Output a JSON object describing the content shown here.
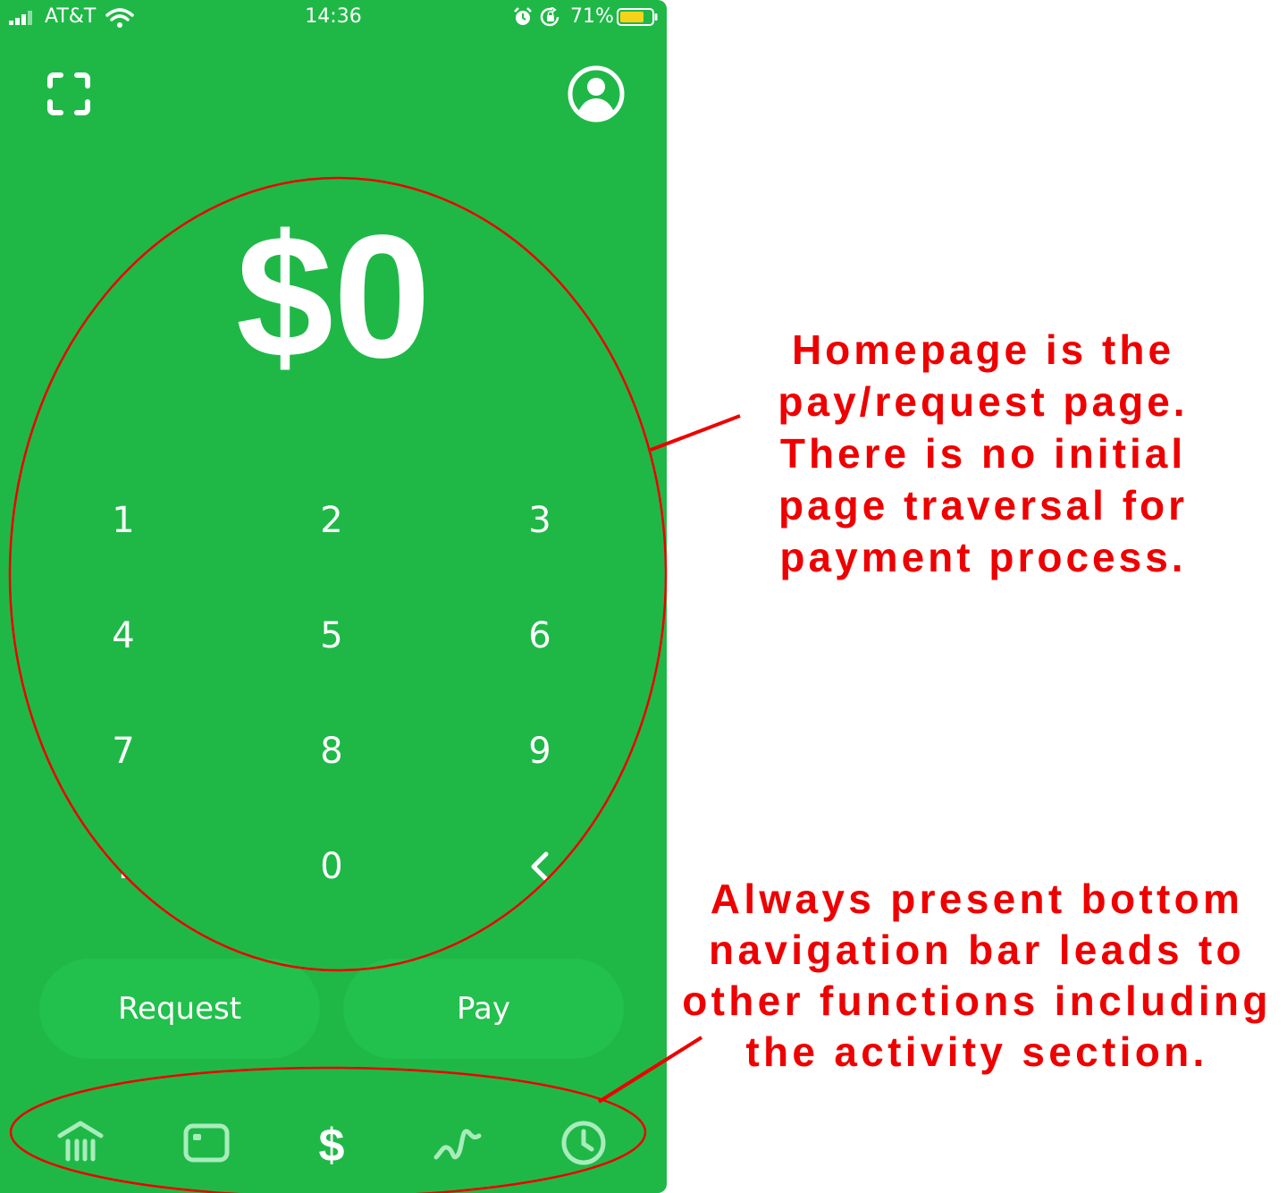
{
  "status_bar": {
    "carrier": "AT&T",
    "time": "14:36",
    "battery_percent": "71%"
  },
  "top_bar": {
    "scan_icon": "scan-qr-icon",
    "profile_icon": "profile-icon"
  },
  "amount": "$0",
  "keypad": {
    "keys": [
      "1",
      "2",
      "3",
      "4",
      "5",
      "6",
      "7",
      "8",
      "9",
      ".",
      "0"
    ],
    "backspace_icon": "chevron-left-icon"
  },
  "actions": {
    "request_label": "Request",
    "pay_label": "Pay"
  },
  "bottom_nav": {
    "items": [
      "bank-icon",
      "card-icon",
      "dollar-icon",
      "investing-icon",
      "activity-clock-icon"
    ]
  },
  "annotations": {
    "note_1_lines": [
      "Homepage is the",
      "pay/request page.",
      "There is no initial",
      "page traversal for",
      "payment process."
    ],
    "note_2_lines": [
      "Always present bottom",
      "navigation bar leads to",
      "other functions including",
      "the activity section."
    ]
  },
  "colors": {
    "app_green": "#1fb847",
    "button_green": "#22c04c",
    "annotation_red": "#ee0000"
  }
}
